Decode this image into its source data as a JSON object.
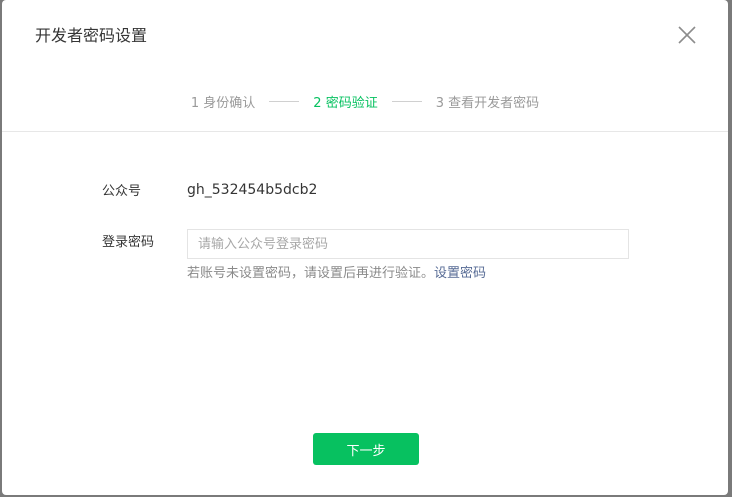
{
  "dialog": {
    "title": "开发者密码设置",
    "close_icon": "close-icon"
  },
  "steps": [
    {
      "label": "1 身份确认",
      "state": "done"
    },
    {
      "label": "2 密码验证",
      "state": "active"
    },
    {
      "label": "3 查看开发者密码",
      "state": "pending"
    }
  ],
  "form": {
    "account_label": "公众号",
    "account_value": "gh_532454b5dcb2",
    "password_label": "登录密码",
    "password_placeholder": "请输入公众号登录密码",
    "password_value": "",
    "hint_text": "若账号未设置密码，请设置后再进行验证。",
    "hint_link": "设置密码"
  },
  "actions": {
    "next_label": "下一步"
  },
  "colors": {
    "accent": "#07c160",
    "link": "#576b95"
  }
}
